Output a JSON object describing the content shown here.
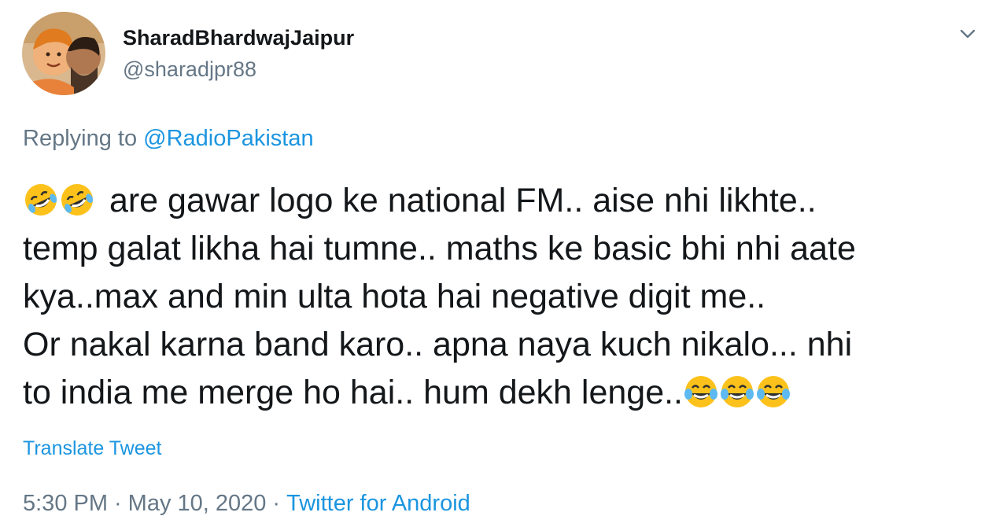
{
  "tweet": {
    "display_name": "SharadBhardwajJaipur",
    "handle": "@sharadjpr88",
    "avatar_icon": "profile-photo-avatar",
    "menu_icon": "chevron-down-icon",
    "reply_prefix": "Replying to",
    "reply_mention": "@RadioPakistan",
    "body_lines": [
      "are gawar logo ke national FM.. aise nhi likhte..",
      "temp galat likha hai tumne.. maths ke basic bhi nhi aate",
      "kya..max and min ulta hota hai negative digit me..",
      "Or nakal karna band karo.. apna naya kuch nikalo... nhi",
      "to india me merge ho hai.. hum dekh lenge.."
    ],
    "leading_emoji": "rolling-on-floor-laughing-emoji",
    "trailing_emoji": "face-with-tears-of-joy-emoji",
    "translate_label": "Translate Tweet",
    "time": "5:30 PM",
    "date": "May 10, 2020",
    "separator": "·",
    "source": "Twitter for Android"
  },
  "colors": {
    "text": "#14171a",
    "secondary": "#657786",
    "link": "#1b95e0",
    "emoji": "#fcc21b"
  }
}
